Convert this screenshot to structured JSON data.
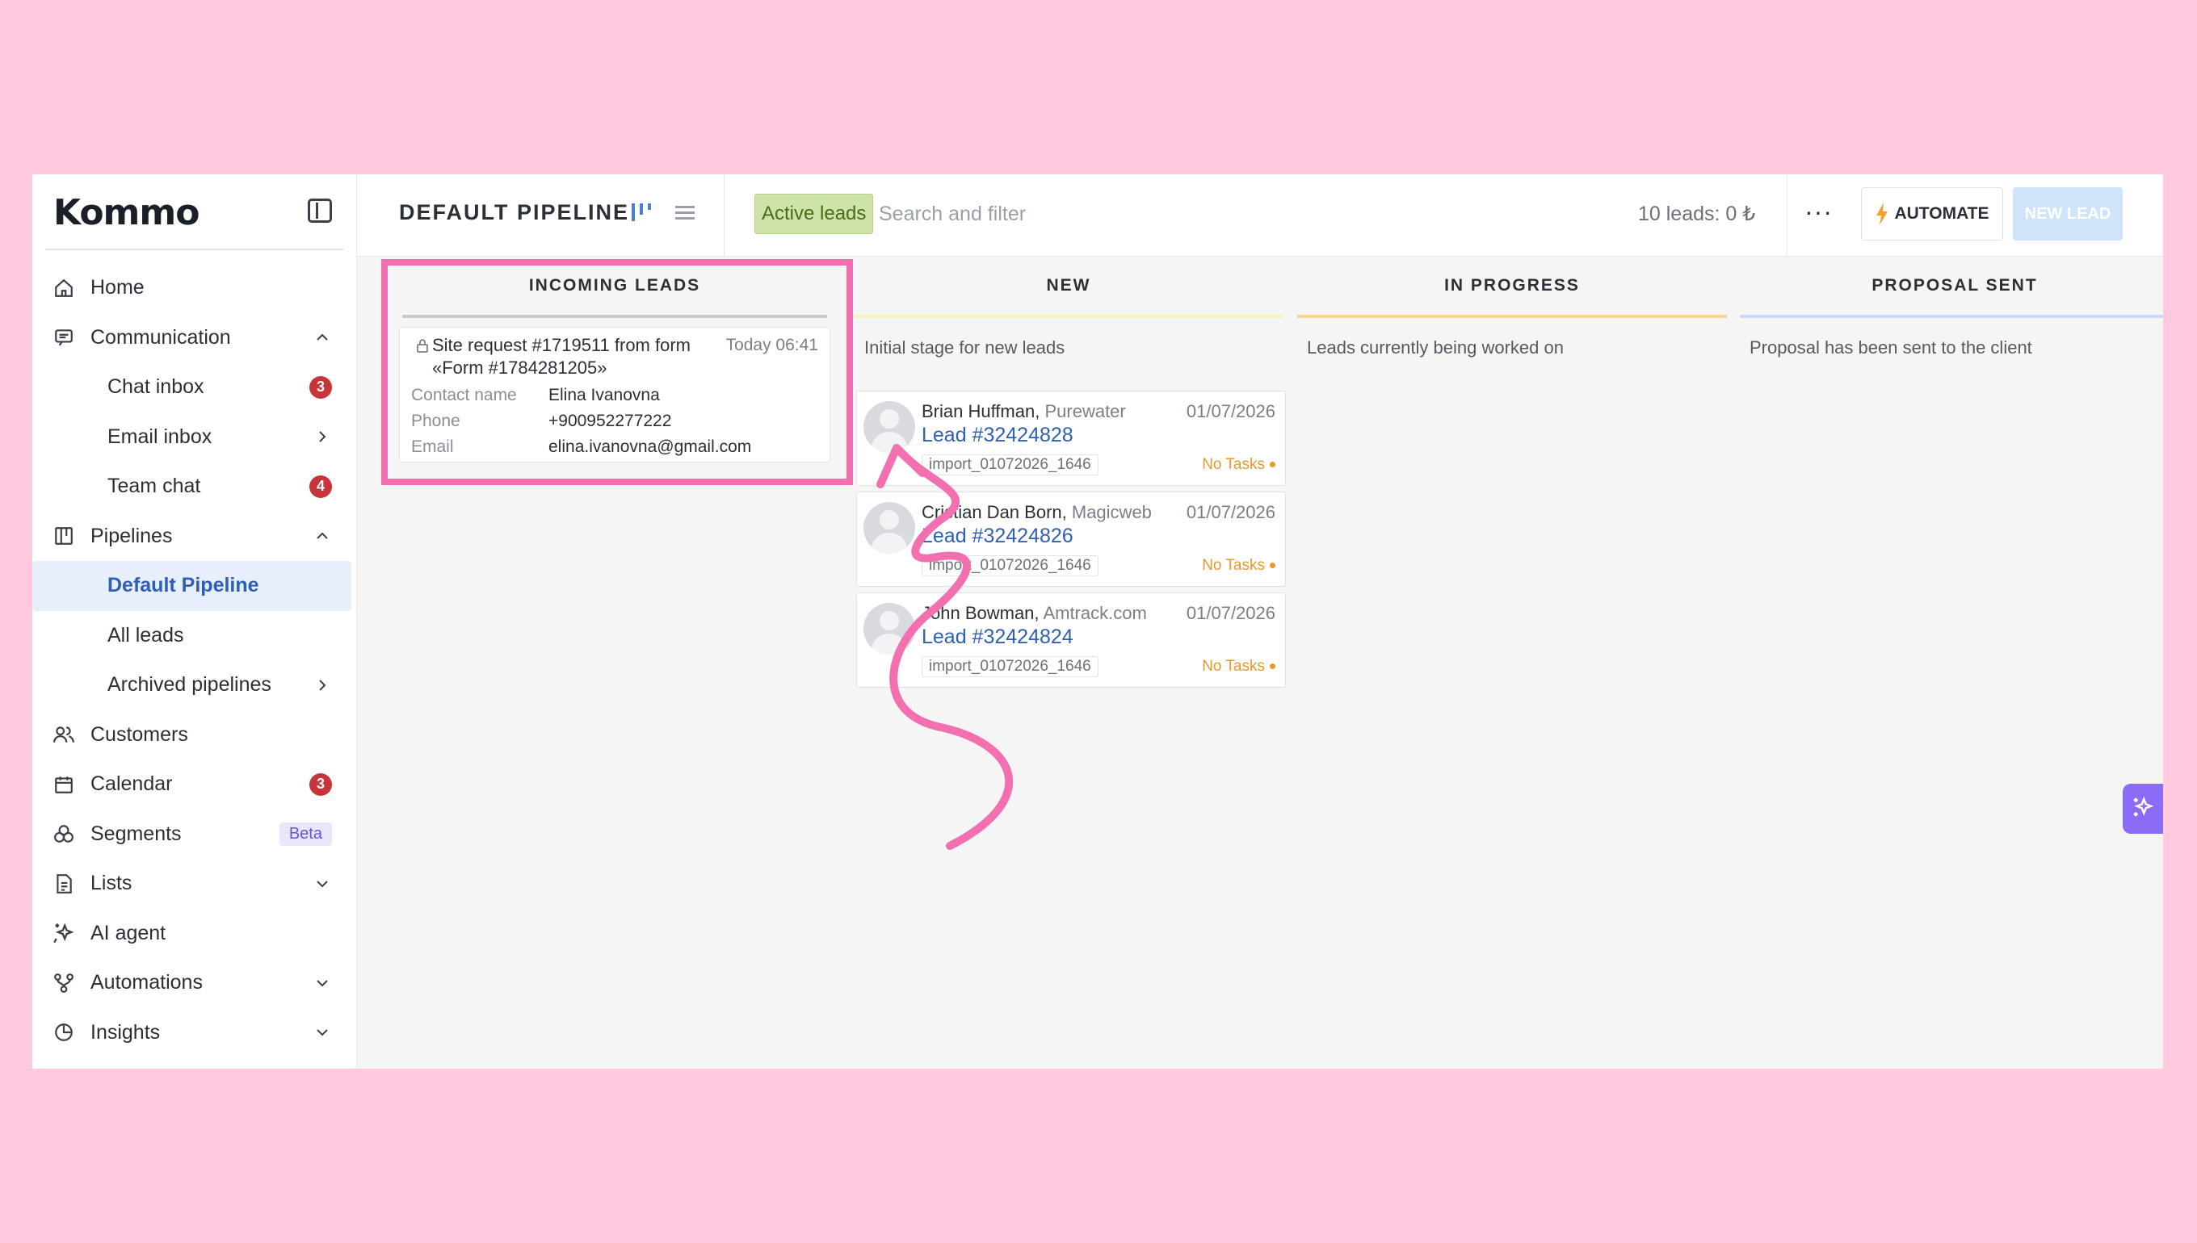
{
  "brand": {
    "logo": "Kommo"
  },
  "sidebar": {
    "items": [
      {
        "label": "Home",
        "icon": "home-icon"
      },
      {
        "label": "Communication",
        "icon": "chat-icon",
        "expanded": true
      },
      {
        "label": "Chat inbox",
        "badge": "3"
      },
      {
        "label": "Email inbox"
      },
      {
        "label": "Team chat",
        "badge": "4"
      },
      {
        "label": "Pipelines",
        "icon": "pipeline-icon",
        "expanded": true
      },
      {
        "label": "Default Pipeline",
        "active": true
      },
      {
        "label": "All leads"
      },
      {
        "label": "Archived pipelines"
      },
      {
        "label": "Customers",
        "icon": "users-icon"
      },
      {
        "label": "Calendar",
        "icon": "calendar-icon",
        "badge": "3"
      },
      {
        "label": "Segments",
        "icon": "segments-icon",
        "tag": "Beta"
      },
      {
        "label": "Lists",
        "icon": "document-icon"
      },
      {
        "label": "AI agent",
        "icon": "sparkle-icon"
      },
      {
        "label": "Automations",
        "icon": "flow-icon"
      },
      {
        "label": "Insights",
        "icon": "pie-icon"
      }
    ]
  },
  "header": {
    "title": "DEFAULT PIPELINE",
    "filter_tag": "Active leads",
    "search_placeholder": "Search and filter",
    "leads_count": "10 leads: 0 ₺",
    "more": "···",
    "automate_label": "AUTOMATE",
    "new_lead_label": "NEW LEAD"
  },
  "columns": [
    {
      "title": "INCOMING LEADS",
      "description": "",
      "color": "#c8cacd"
    },
    {
      "title": "NEW",
      "description": "Initial stage for new leads",
      "color": "#f6f3b9"
    },
    {
      "title": "IN PROGRESS",
      "description": "Leads currently being worked on",
      "color": "#f6d98e"
    },
    {
      "title": "PROPOSAL SENT",
      "description": "Proposal has been sent to the client",
      "color": "#c9dcf6"
    }
  ],
  "incoming": {
    "title": "Site request #1719511 from form «Form #1784281205»",
    "time": "Today 06:41",
    "fields": [
      {
        "key": "Contact name",
        "value": "Elina Ivanovna"
      },
      {
        "key": "Phone",
        "value": "+900952277222"
      },
      {
        "key": "Email",
        "value": "elina.ivanovna@gmail.com"
      }
    ]
  },
  "leads": [
    {
      "name": "Brian Huffman,",
      "company": "Purewater",
      "date": "01/07/2026",
      "lead": "Lead #32424828",
      "tag": "import_01072026_1646",
      "tasks": "No Tasks"
    },
    {
      "name": "Cristian Dan Born,",
      "company": "Magicweb",
      "date": "01/07/2026",
      "lead": "Lead #32424826",
      "tag": "import_01072026_1646",
      "tasks": "No Tasks"
    },
    {
      "name": "John Bowman,",
      "company": "Amtrack.com",
      "date": "01/07/2026",
      "lead": "Lead #32424824",
      "tag": "import_01072026_1646",
      "tasks": "No Tasks"
    }
  ],
  "colors": {
    "accent": "#2f5fb5",
    "highlight": "#f26fb0",
    "background": "#ffc9e0",
    "badge": "#c7353b"
  }
}
